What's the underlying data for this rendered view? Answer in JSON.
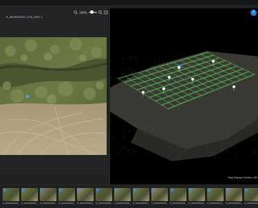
{
  "viewer": {
    "zoom_label": "100%",
    "filename": "IL_W000000041_0TX_0.JPG"
  },
  "map_status": "Map Display Section (49)",
  "help_icon": "help-icon",
  "colors": {
    "accent": "#2d8cf0",
    "path": "#59d15a"
  },
  "filmstrip": [
    {
      "label": "IL_W00000000_0T5"
    },
    {
      "label": "IL_W00000001_0T5"
    },
    {
      "label": "IL_W00000002_0T5"
    },
    {
      "label": "IL_W00000003_0T5"
    },
    {
      "label": "IL_W00000004_0T5"
    },
    {
      "label": "IL_W00000005_0T5"
    },
    {
      "label": "IL_W00000006_0T5"
    },
    {
      "label": "IL_W00000007_0T5"
    },
    {
      "label": "IL_W00000008_0T5"
    },
    {
      "label": "IL_W00000009_0T5"
    },
    {
      "label": "IL_W00000010_0T5"
    },
    {
      "label": "IL_W00000011_0T5"
    },
    {
      "label": "IL_W00000012_0T5"
    },
    {
      "label": "IL_W00000013_0T5"
    }
  ]
}
